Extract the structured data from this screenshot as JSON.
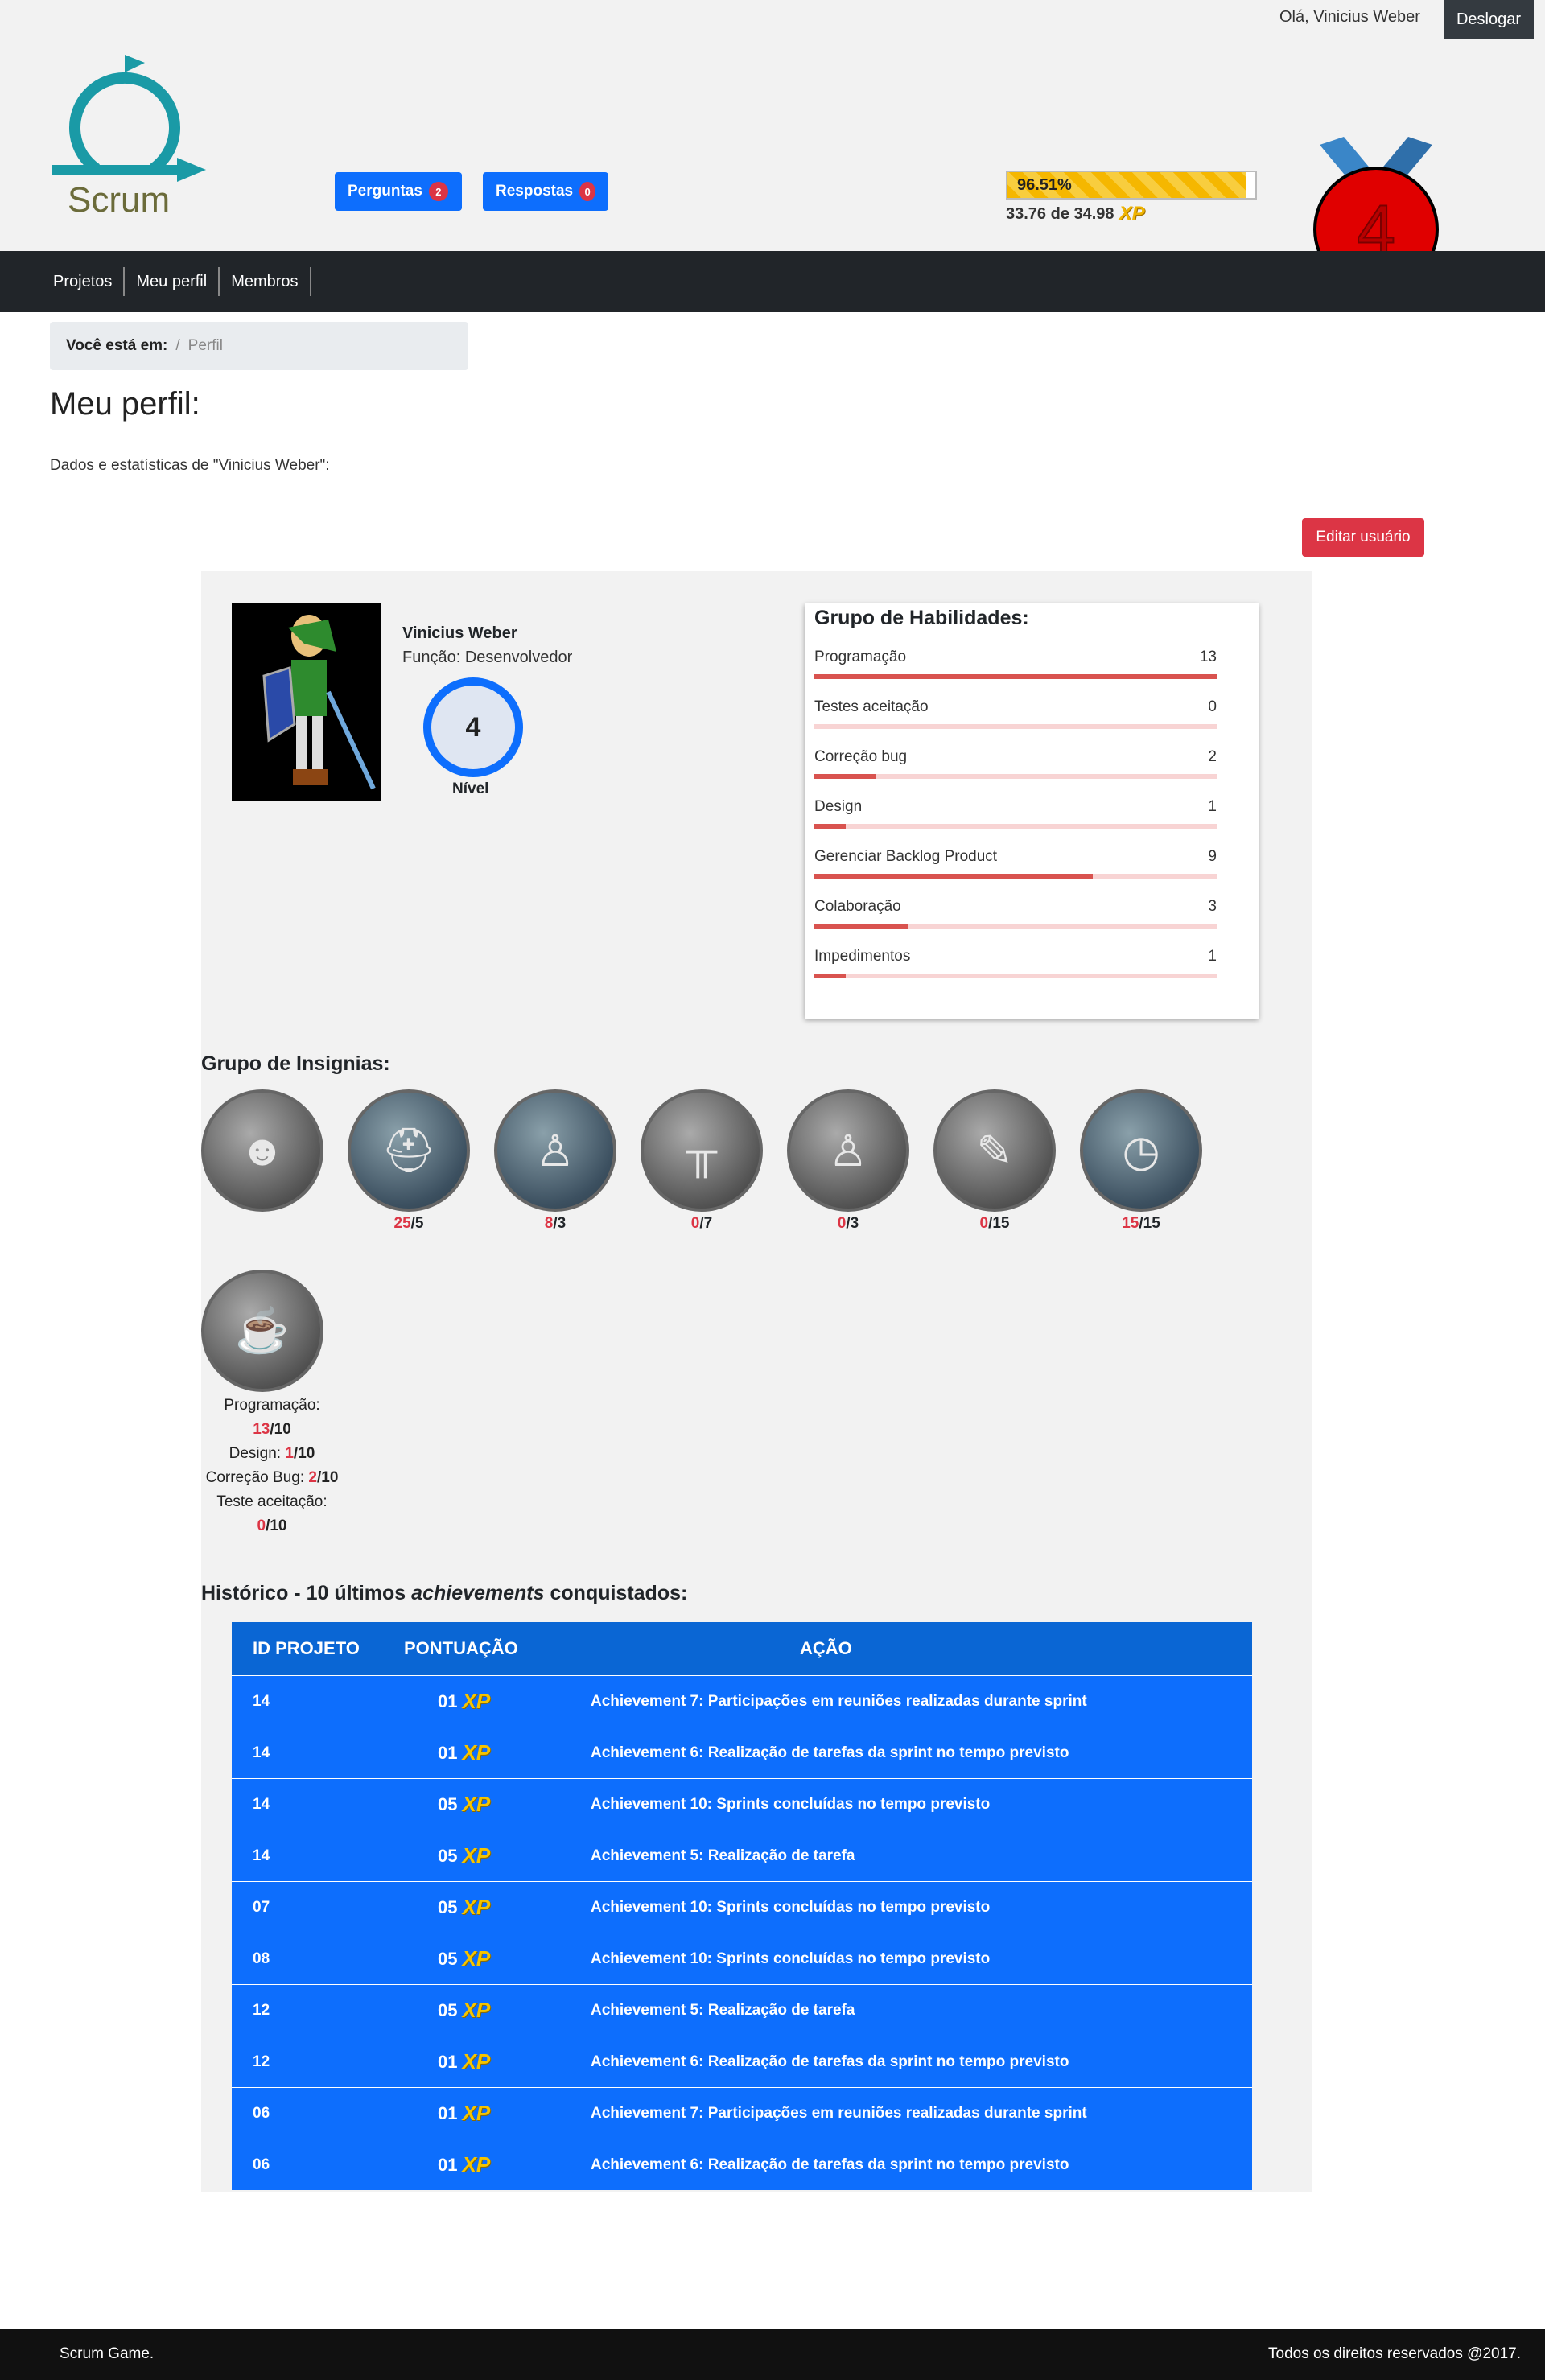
{
  "header": {
    "greeting": "Olá, Vinicius Weber",
    "logout_label": "Deslogar",
    "logo_text": "Scrum",
    "perguntas_label": "Perguntas",
    "perguntas_count": "2",
    "respostas_label": "Respostas",
    "respostas_count": "0",
    "xp_percent_label": "96.51%",
    "xp_progress": 0.9651,
    "xp_text": "33.76 de 34.98",
    "xp_icon": "XP",
    "medal_level": "4"
  },
  "nav": {
    "items": [
      "Projetos",
      "Meu perfil",
      "Membros"
    ]
  },
  "breadcrumb": {
    "label": "Você está em:",
    "separator": "/",
    "current": "Perfil"
  },
  "page": {
    "title": "Meu perfil:",
    "subtitle": "Dados e estatísticas de \"Vinicius Weber\":",
    "edit_label": "Editar usuário"
  },
  "profile": {
    "name": "Vinicius Weber",
    "role": "Função: Desenvolvedor",
    "level": "4",
    "level_label": "Nível"
  },
  "skills": {
    "title": "Grupo de Habilidades:",
    "items": [
      {
        "name": "Programação",
        "value": "13",
        "fill": 1.0
      },
      {
        "name": "Testes aceitação",
        "value": "0",
        "fill": 0.0
      },
      {
        "name": "Correção bug",
        "value": "2",
        "fill": 0.154
      },
      {
        "name": "Design",
        "value": "1",
        "fill": 0.077
      },
      {
        "name": "Gerenciar Backlog Product",
        "value": "9",
        "fill": 0.692
      },
      {
        "name": "Colaboração",
        "value": "3",
        "fill": 0.231
      },
      {
        "name": "Impedimentos",
        "value": "1",
        "fill": 0.077
      }
    ]
  },
  "insignias": {
    "title": "Grupo de Insignias:",
    "badges": [
      {
        "icon": "meeting-icon",
        "glyph": "☻",
        "count": "",
        "total": ""
      },
      {
        "icon": "helmet-icon",
        "glyph": "⛑",
        "count": "25",
        "total": "/5"
      },
      {
        "icon": "worker-icon",
        "glyph": "♙",
        "count": "8",
        "total": "/3"
      },
      {
        "icon": "hurdle-icon",
        "glyph": "╥",
        "count": "0",
        "total": "/7"
      },
      {
        "icon": "blueprint-icon",
        "glyph": "♙",
        "count": "0",
        "total": "/3"
      },
      {
        "icon": "tasks-icon",
        "glyph": "✎",
        "count": "0",
        "total": "/15"
      },
      {
        "icon": "stopwatch-icon",
        "glyph": "◷",
        "count": "15",
        "total": "/15"
      },
      {
        "icon": "no-test-icon",
        "glyph": "☕",
        "count": "",
        "total": ""
      }
    ],
    "programming_label": "Programação:",
    "programming_count": "13",
    "programming_total": "/10",
    "design_label": "Design:",
    "design_count": "1",
    "design_total": "/10",
    "bug_label": "Correção Bug:",
    "bug_count": "2",
    "bug_total": "/10",
    "test_label": "Teste aceitação:",
    "test_count": "0",
    "test_total": "/10"
  },
  "history": {
    "title_prefix": "Histórico - 10 últimos ",
    "title_em": "achievements",
    "title_suffix": " conquistados:",
    "columns": [
      "ID PROJETO",
      "PONTUAÇÃO",
      "AÇÃO"
    ],
    "xp_icon": "XP",
    "rows": [
      {
        "id": "14",
        "points": "01",
        "action": "Achievement 7: Participações em reuniões realizadas durante sprint"
      },
      {
        "id": "14",
        "points": "01",
        "action": "Achievement 6: Realização de tarefas da sprint no tempo previsto"
      },
      {
        "id": "14",
        "points": "05",
        "action": "Achievement 10: Sprints concluídas no tempo previsto"
      },
      {
        "id": "14",
        "points": "05",
        "action": "Achievement 5: Realização de tarefa"
      },
      {
        "id": "07",
        "points": "05",
        "action": "Achievement 10: Sprints concluídas no tempo previsto"
      },
      {
        "id": "08",
        "points": "05",
        "action": "Achievement 10: Sprints concluídas no tempo previsto"
      },
      {
        "id": "12",
        "points": "05",
        "action": "Achievement 5: Realização de tarefa"
      },
      {
        "id": "12",
        "points": "01",
        "action": "Achievement 6: Realização de tarefas da sprint no tempo previsto"
      },
      {
        "id": "06",
        "points": "01",
        "action": "Achievement 7: Participações em reuniões realizadas durante sprint"
      },
      {
        "id": "06",
        "points": "01",
        "action": "Achievement 6: Realização de tarefas da sprint no tempo previsto"
      }
    ]
  },
  "footer": {
    "left": "Scrum Game.",
    "right": "Todos os direitos reservados @2017."
  },
  "colors": {
    "primary": "#0d6efd",
    "danger": "#dc3545",
    "navbar": "#212529",
    "teal_logo": "#1a9aa6"
  }
}
